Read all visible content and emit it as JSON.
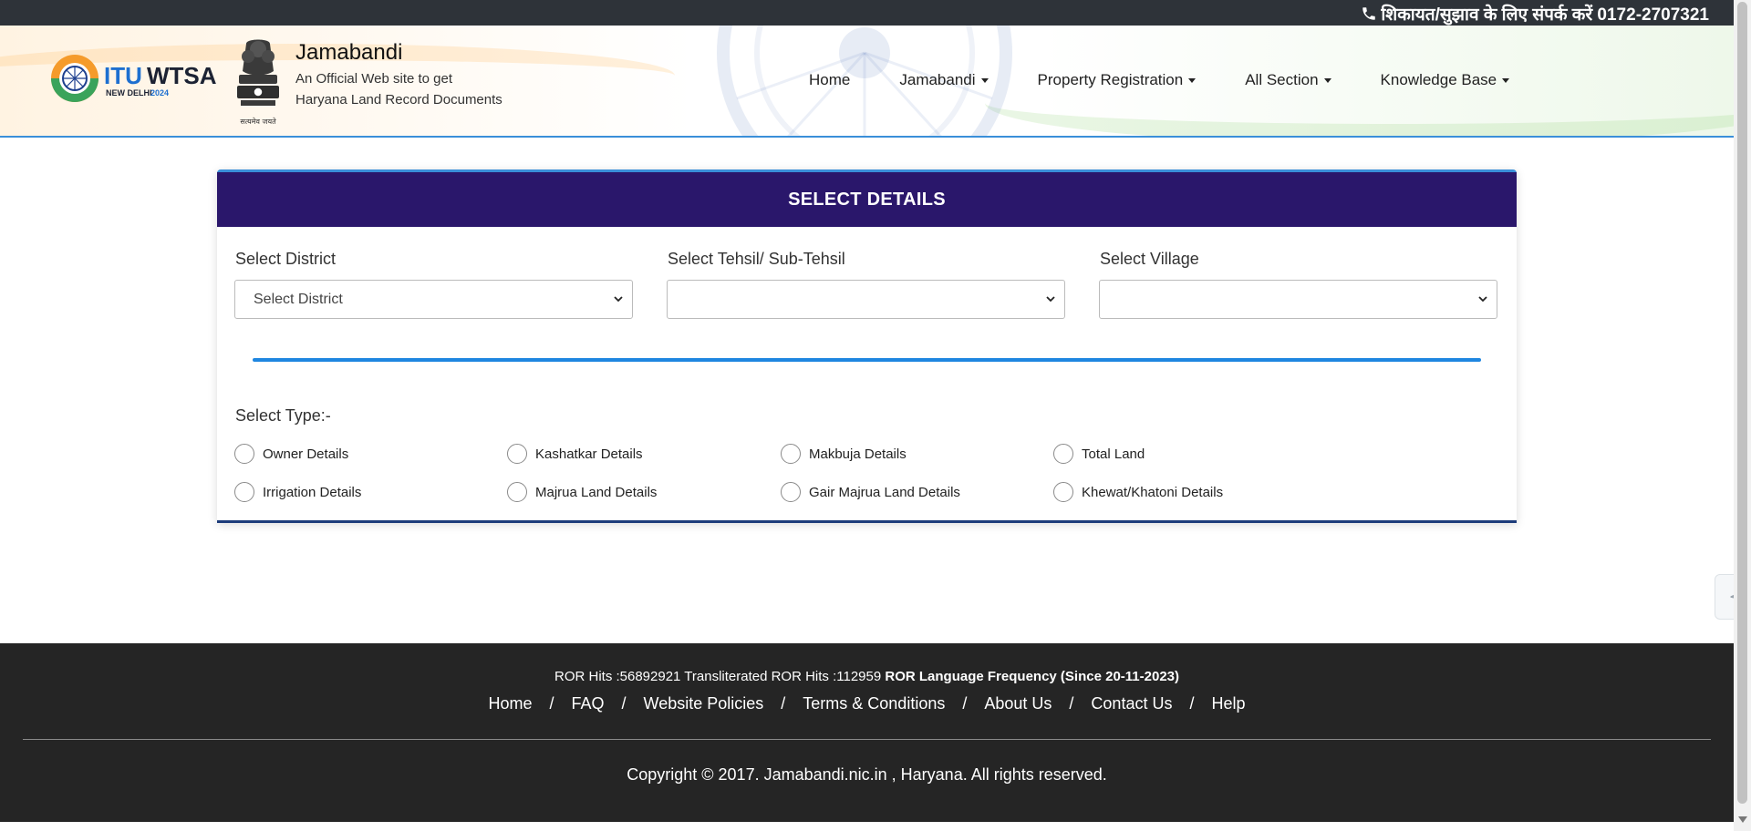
{
  "topbar": {
    "contact_text": "शिकायत/सुझाव के लिए संपर्क करें 0172-2707321",
    "icon": "phone-icon"
  },
  "header": {
    "logo_text": "ITUWTSA",
    "logo_sub": "NEW DELHI 2024",
    "emblem_motto": "सत्यमेव जयते",
    "title": "Jamabandi",
    "subtitle_line1": "An Official Web site to get",
    "subtitle_line2": "Haryana Land Record Documents"
  },
  "nav": {
    "items": [
      {
        "label": "Home",
        "dropdown": false
      },
      {
        "label": "Jamabandi",
        "dropdown": true
      },
      {
        "label": "Property Registration",
        "dropdown": true
      },
      {
        "label": "All Section",
        "dropdown": true
      },
      {
        "label": "Knowledge Base",
        "dropdown": true
      }
    ]
  },
  "form": {
    "heading": "SELECT DETAILS",
    "district": {
      "label": "Select District",
      "value": "Select District"
    },
    "tehsil": {
      "label": "Select Tehsil/ Sub-Tehsil",
      "value": ""
    },
    "village": {
      "label": "Select Village",
      "value": ""
    },
    "type_label": "Select Type:-",
    "types": [
      "Owner Details",
      "Kashatkar Details",
      "Makbuja Details",
      "Total Land",
      "Irrigation Details",
      "Majrua Land Details",
      "Gair Majrua Land Details",
      "Khewat/Khatoni Details"
    ]
  },
  "footer": {
    "hits_text": "ROR Hits :56892921 Transliterated ROR Hits :112959",
    "frequency_text": "ROR Language Frequency (Since 20-11-2023)",
    "links": [
      "Home",
      "FAQ",
      "Website Policies",
      "Terms & Conditions",
      "About Us",
      "Contact Us",
      "Help"
    ],
    "separator": "/",
    "copyright": "Copyright © 2017. Jamabandi.nic.in , Haryana. All rights reserved."
  },
  "colors": {
    "header_bar": "#2a176b",
    "accent_blue": "#1f86e0",
    "footer_bg": "#252525",
    "topbar_bg": "#2e3339"
  }
}
